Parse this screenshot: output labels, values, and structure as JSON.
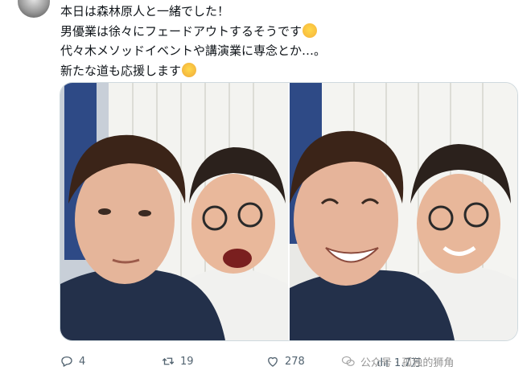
{
  "tweet": {
    "lines": [
      "本日は森林原人と一緒でした！",
      "男優業は徐々にフェードアウトするそうです",
      "代々木メソッドイベントや講演業に専念とか…。",
      "新たな道も応援します"
    ]
  },
  "media": {
    "photos": [
      {
        "icon": "two-men-selfie-photo"
      },
      {
        "icon": "two-men-smiling-selfie-photo"
      }
    ]
  },
  "actions": {
    "replies": "4",
    "reposts": "19",
    "likes": "278",
    "views": "1.7万"
  },
  "watermark": {
    "text": "公众号 · 孤独的狮角"
  },
  "colors": {
    "text": "#0f1419",
    "muted": "#536471",
    "border": "#cfd9de"
  }
}
